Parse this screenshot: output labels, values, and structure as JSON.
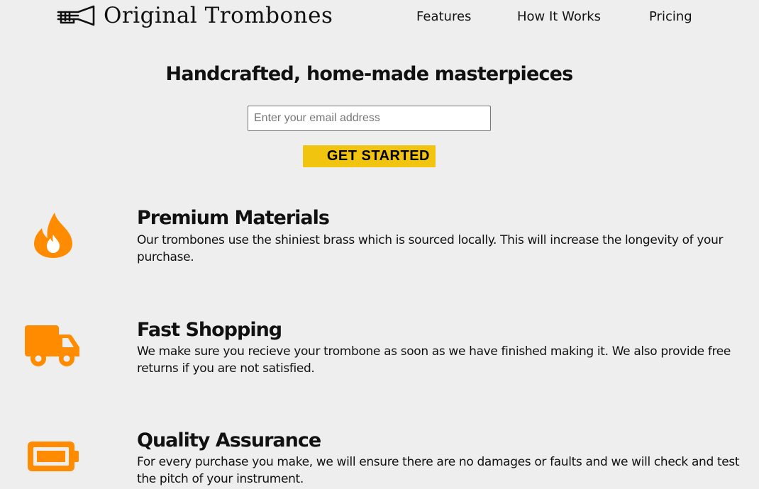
{
  "brand": {
    "name": "Original Trombones",
    "logo_icon": "trombone-icon"
  },
  "nav": {
    "items": [
      {
        "label": "Features"
      },
      {
        "label": "How It Works"
      },
      {
        "label": "Pricing"
      }
    ]
  },
  "hero": {
    "title": "Handcrafted, home-made masterpieces",
    "email_placeholder": "Enter your email address",
    "email_value": "",
    "cta_label": "GET STARTED"
  },
  "colors": {
    "background": "#eeeeee",
    "accent_orange": "#ff8c00",
    "button_yellow": "#f1c40f"
  },
  "features": [
    {
      "icon": "fire-icon",
      "title": "Premium Materials",
      "description": "Our trombones use the shiniest brass which is sourced locally. This will increase the longevity of your purchase."
    },
    {
      "icon": "truck-icon",
      "title": "Fast Shopping",
      "description": "We make sure you recieve your trombone as soon as we have finished making it. We also provide free returns if you are not satisfied."
    },
    {
      "icon": "battery-icon",
      "title": "Quality Assurance",
      "description": "For every purchase you make, we will ensure there are no damages or faults and we will check and test the pitch of your instrument."
    }
  ]
}
